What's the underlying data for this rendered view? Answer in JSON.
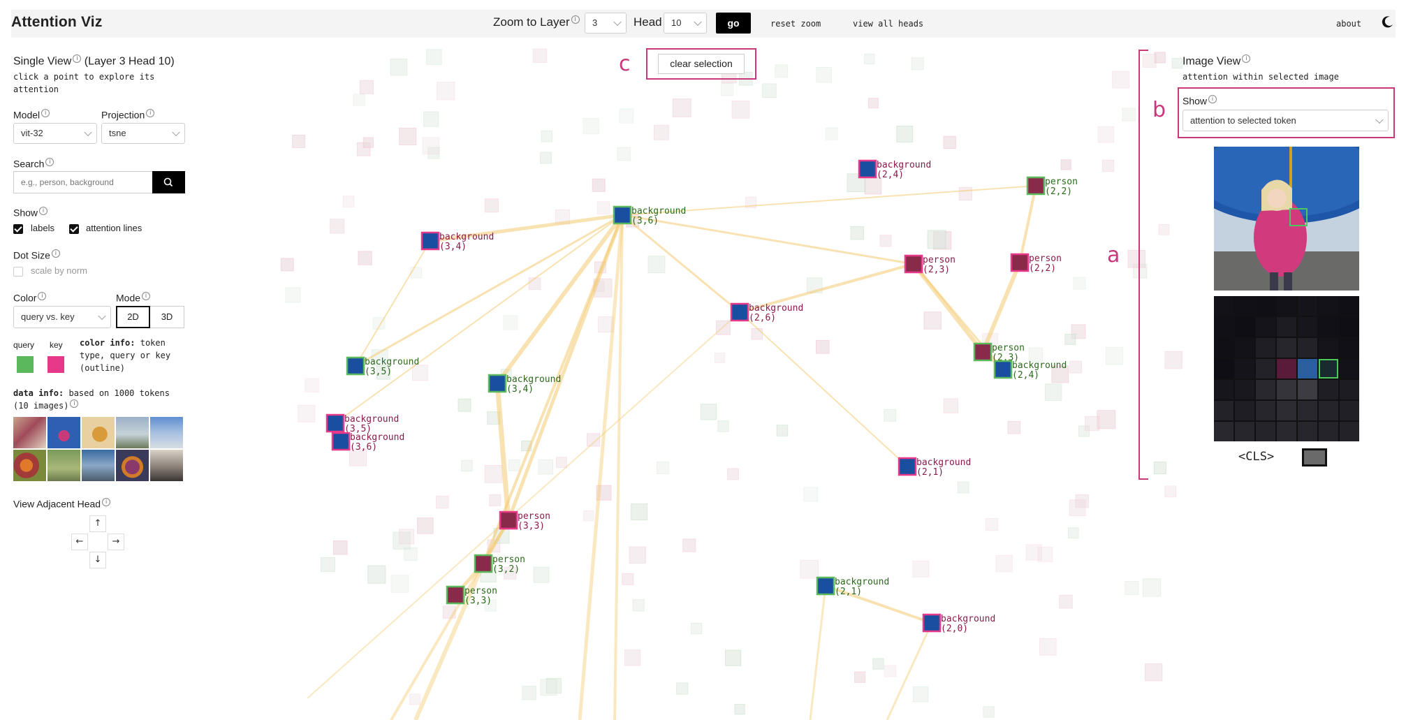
{
  "header": {
    "title": "Attention Viz",
    "zoom_label": "Zoom to Layer",
    "zoom_value": "3",
    "head_label": "Head",
    "head_value": "10",
    "go": "go",
    "reset_zoom": "reset zoom",
    "view_all_heads": "view all heads",
    "about": "about"
  },
  "sidebar": {
    "single_view": "Single View",
    "layer_head": "(Layer 3 Head 10)",
    "hint_1": "click a point to explore its",
    "hint_2": "attention",
    "model_label": "Model",
    "model_value": "vit-32",
    "projection_label": "Projection",
    "projection_value": "tsne",
    "search_label": "Search",
    "search_placeholder": "e.g., person, background",
    "show_label": "Show",
    "labels_opt": "labels",
    "attention_lines_opt": "attention lines",
    "dot_size_label": "Dot Size",
    "scale_by_norm": "scale by norm",
    "color_label": "Color",
    "color_value": "query vs. key",
    "mode_label": "Mode",
    "mode_2d": "2D",
    "mode_3d": "3D",
    "query": "query",
    "key": "key",
    "color_info_title": "color info:",
    "color_info_1": "token",
    "color_info_2": "type, query or key",
    "color_info_3": "(outline)",
    "data_info_title": "data info:",
    "data_info_1": "based on 1000 tokens",
    "data_info_2": "(10 images)",
    "adjacent_label": "View Adjacent Head",
    "query_color": "#5cb85c",
    "key_color": "#e8388a"
  },
  "canvas": {
    "clear_selection": "clear selection",
    "points": [
      {
        "label": "background",
        "coord": "(3,4)",
        "type": "key"
      },
      {
        "label": "background",
        "coord": "(3,6)",
        "type": "query"
      },
      {
        "label": "background",
        "coord": "(3,5)",
        "type": "query"
      },
      {
        "label": "background",
        "coord": "(3,4)",
        "type": "query"
      },
      {
        "label": "background",
        "coord": "(3,5)",
        "type": "key"
      },
      {
        "label": "background",
        "coord": "(3,6)",
        "type": "key"
      },
      {
        "label": "background",
        "coord": "(2,6)",
        "type": "key"
      },
      {
        "label": "background",
        "coord": "(2,4)",
        "type": "key"
      },
      {
        "label": "person",
        "coord": "(2,2)",
        "type": "query"
      },
      {
        "label": "person",
        "coord": "(2,3)",
        "type": "key"
      },
      {
        "label": "person",
        "coord": "(2,2)",
        "type": "key"
      },
      {
        "label": "person",
        "coord": "(2,3)",
        "type": "query"
      },
      {
        "label": "background",
        "coord": "(2,4)",
        "type": "query"
      },
      {
        "label": "background",
        "coord": "(2,1)",
        "type": "key"
      },
      {
        "label": "person",
        "coord": "(3,3)",
        "type": "key"
      },
      {
        "label": "person",
        "coord": "(3,2)",
        "type": "query"
      },
      {
        "label": "person",
        "coord": "(3,3)",
        "type": "query"
      },
      {
        "label": "background",
        "coord": "(2,1)",
        "type": "query"
      },
      {
        "label": "background",
        "coord": "(2,0)",
        "type": "key"
      }
    ]
  },
  "image_view": {
    "title": "Image View",
    "subtitle": "attention within selected image",
    "show_label": "Show",
    "show_value": "attention to selected token",
    "cls": "<CLS>"
  },
  "annotations": {
    "a": "a",
    "b": "b",
    "c": "c"
  }
}
